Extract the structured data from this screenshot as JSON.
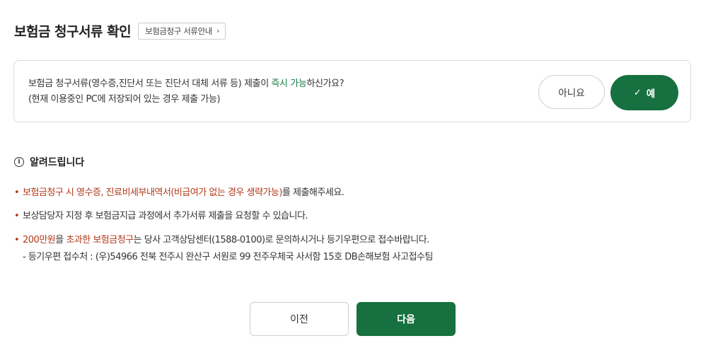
{
  "header": {
    "title": "보험금 청구서류 확인",
    "guide_button": "보험금청구 서류안내",
    "guide_chevron": "›"
  },
  "question": {
    "line1_prefix": "보험금 청구서류(영수증,진단서 또는 진단서 대체 서류 등) 제출이 ",
    "line1_accent": "즉시 가능",
    "line1_suffix": "하신가요?",
    "line2": "(현재 이용중인 PC에 저장되어 있는 경우 제출 가능)",
    "no_label": "아니요",
    "yes_label": "예",
    "yes_check": "✓",
    "selected": "예"
  },
  "notice": {
    "heading": "알려드립니다",
    "icon": "info-icon",
    "items": [
      {
        "bullet": "•",
        "red": "보험금청구 시 영수증, 진료비세부내역서(비급여가 없는 경우 생략가능)",
        "rest": "를 제출해주세요."
      },
      {
        "bullet": "•",
        "text": "보상담당자 지정 후 보험금지급 과정에서 추가서류 제출을 요청할 수 있습니다."
      },
      {
        "bullet": "•",
        "red1": "200만원",
        "mid": "을 ",
        "red2": "초과한 보험금청구",
        "rest": "는 당사 고객상담센터(1588-0100)로 문의하시거나 등기우편으로 접수바랍니다.",
        "sub": "- 등기우편 접수처 : (우)54966 전북 전주시 완산구 서원로 99 전주우체국 사서함 15호 DB손해보험 사고접수팀"
      }
    ]
  },
  "footer": {
    "prev_label": "이전",
    "next_label": "다음"
  },
  "colors": {
    "brand_green": "#17703f",
    "accent_green": "#1a7a45",
    "notice_red": "#b23a1a"
  }
}
